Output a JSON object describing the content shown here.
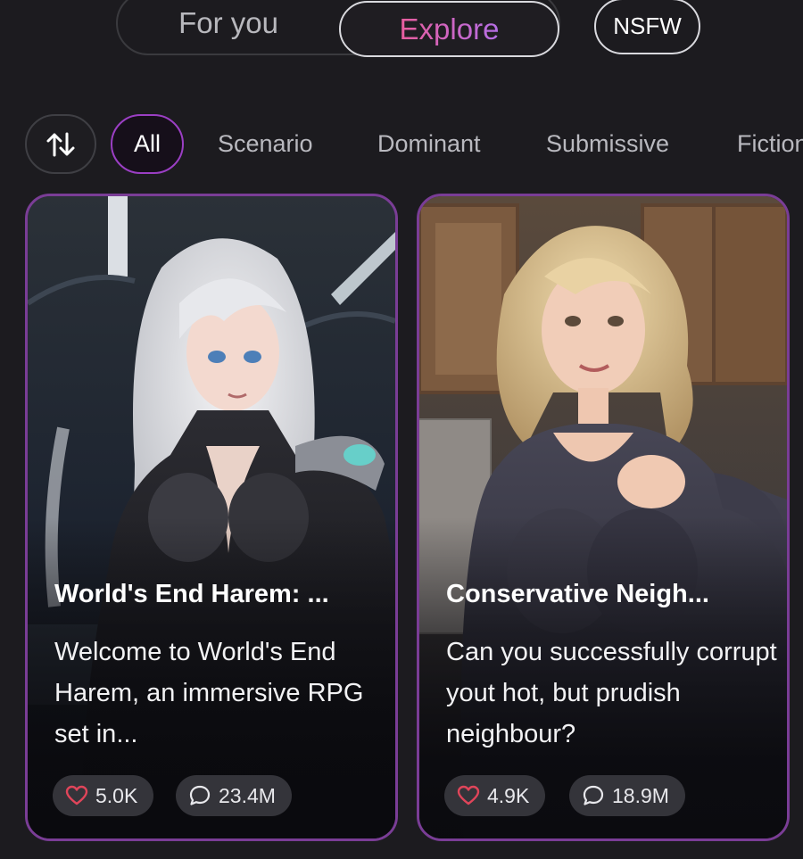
{
  "top_tabs": {
    "for_you": "For you",
    "explore": "Explore",
    "nsfw": "NSFW"
  },
  "filters": {
    "sort_icon": "sort-arrows-icon",
    "chips": [
      "All",
      "Scenario",
      "Dominant",
      "Submissive",
      "Fiction"
    ]
  },
  "cards": [
    {
      "title": "World's End Harem: ...",
      "description": "Welcome to World's End Harem, an immersive RPG set in...",
      "likes": "5.0K",
      "comments": "23.4M"
    },
    {
      "title": "Conservative Neigh...",
      "description": "Can you successfully corrupt yout hot, but prudish neighbour?",
      "likes": "4.9K",
      "comments": "18.9M"
    }
  ],
  "colors": {
    "background": "#1c1b1f",
    "accent_pink": "#e35fa7",
    "accent_purple": "#9b3fc4",
    "card_border": "#7a3d96",
    "like_icon": "#e0455a"
  },
  "icons": {
    "like": "heart-icon",
    "comment": "chat-bubble-icon"
  }
}
